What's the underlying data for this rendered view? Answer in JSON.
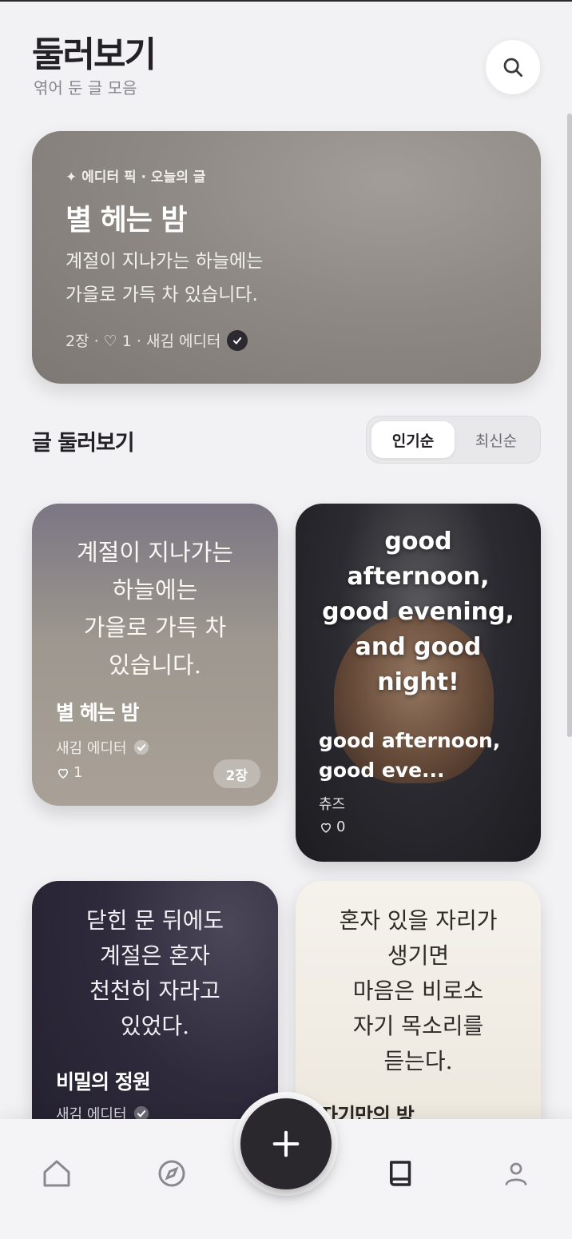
{
  "header": {
    "title": "둘러보기",
    "subtitle": "엮어 둔 글 모음",
    "search_icon": "search-icon"
  },
  "featured": {
    "tag": "✦ 에디터 픽 · 오늘의 글",
    "title": "별 헤는 밤",
    "text_line1": "계절이 지나가는 하늘에는",
    "text_line2": "가을로 가득 차 있습니다.",
    "meta": "2장 · ♡ 1 · 새김 에디터"
  },
  "section": {
    "title": "글 둘러보기",
    "sort_popular": "인기순",
    "sort_latest": "최신순"
  },
  "cards": [
    {
      "quote_lines": [
        "계절이 지나가는",
        "하늘에는",
        "가을로 가득 차",
        "있습니다."
      ],
      "title": "별 헤는 밤",
      "author": "새김 에디터",
      "likes": "1",
      "pages": "2장"
    },
    {
      "quote_lines": [
        "good",
        "afternoon,",
        "good evening,",
        "and good",
        "night!"
      ],
      "title_line1": "good afternoon,",
      "title_line2": "good eve...",
      "author": "츄즈",
      "likes": "0"
    },
    {
      "quote_lines": [
        "닫힌 문 뒤에도",
        "계절은 혼자",
        "천천히 자라고",
        "있었다."
      ],
      "title": "비밀의 정원",
      "author": "새김 에디터"
    },
    {
      "quote_lines": [
        "혼자 있을 자리가",
        "생기면",
        "마음은 비로소",
        "자기 목소리를",
        "듣는다."
      ],
      "title": "자기만의 방"
    }
  ],
  "nav": {
    "icons": [
      "home-icon",
      "compass-icon",
      "plus-icon",
      "book-icon",
      "profile-icon"
    ]
  },
  "colors": {
    "background": "#f2f2f4",
    "text_primary": "#232026",
    "fab": "#2a272d"
  }
}
